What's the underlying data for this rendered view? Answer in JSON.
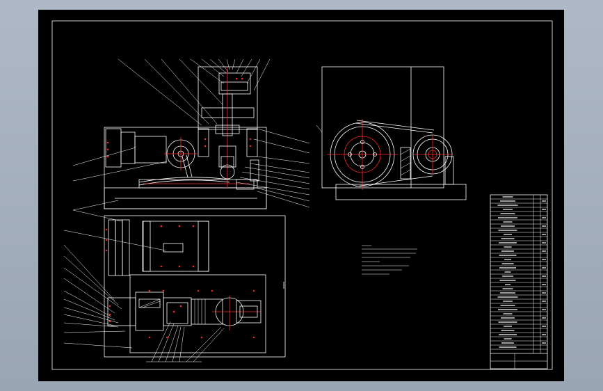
{
  "colors": {
    "background": "#000000",
    "outline": "#ffffff",
    "centerline": "#ff2a2a",
    "viewport": "#a9b3c1"
  },
  "icons": {
    "border": "drawing-border-icon",
    "pulley": "pulley-icon"
  }
}
